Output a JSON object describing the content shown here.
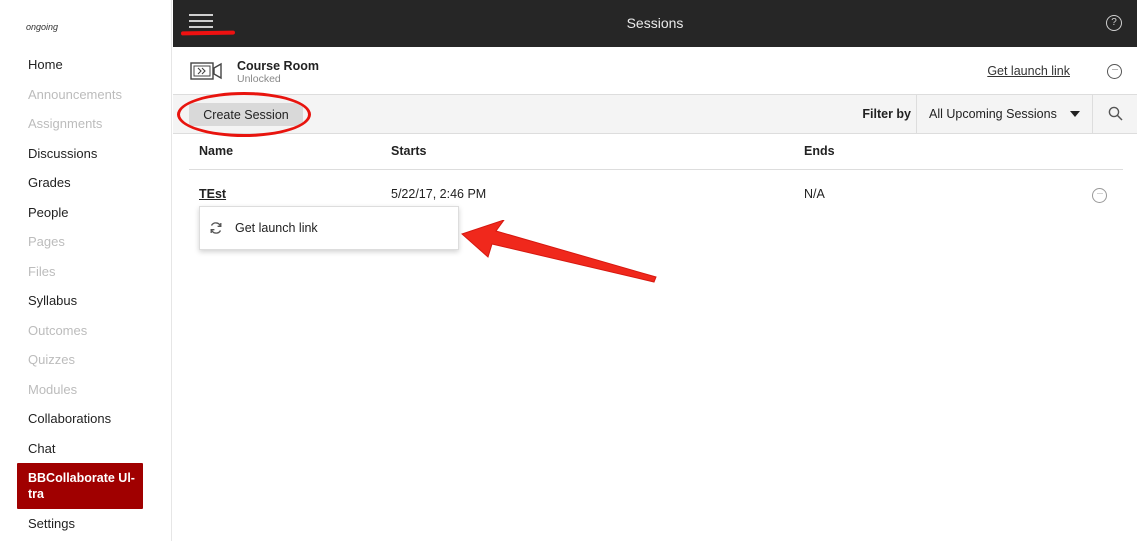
{
  "sidebar": {
    "course_name": "ongoing",
    "items": [
      {
        "label": "Home",
        "state": "enabled"
      },
      {
        "label": "Announcements",
        "state": "disabled"
      },
      {
        "label": "Assignments",
        "state": "disabled"
      },
      {
        "label": "Discussions",
        "state": "enabled"
      },
      {
        "label": "Grades",
        "state": "enabled"
      },
      {
        "label": "People",
        "state": "enabled"
      },
      {
        "label": "Pages",
        "state": "disabled"
      },
      {
        "label": "Files",
        "state": "disabled"
      },
      {
        "label": "Syllabus",
        "state": "enabled"
      },
      {
        "label": "Outcomes",
        "state": "disabled"
      },
      {
        "label": "Quizzes",
        "state": "disabled"
      },
      {
        "label": "Modules",
        "state": "disabled"
      },
      {
        "label": "Collaborations",
        "state": "enabled"
      },
      {
        "label": "Chat",
        "state": "enabled"
      },
      {
        "label": "BBCollaborate Ul-tra",
        "state": "active"
      },
      {
        "label": "Settings",
        "state": "enabled"
      }
    ],
    "active_color": "#a00000"
  },
  "header": {
    "title": "Sessions",
    "menu_icon": "hamburger-icon",
    "help_icon": "help-icon"
  },
  "room": {
    "title": "Course Room",
    "status": "Unlocked",
    "launch_link": "Get launch link",
    "icon": "video-camera-icon"
  },
  "toolbar": {
    "create_label": "Create Session",
    "filter_label": "Filter by",
    "filter_value": "All Upcoming Sessions"
  },
  "table": {
    "columns": {
      "name": "Name",
      "starts": "Starts",
      "ends": "Ends"
    },
    "rows": [
      {
        "name": "TEst",
        "starts": "5/22/17, 2:46 PM",
        "ends": "N/A"
      }
    ]
  },
  "popup": {
    "label": "Get launch link",
    "icon": "refresh-icon"
  },
  "annotations": {
    "color": "#e8140e"
  }
}
